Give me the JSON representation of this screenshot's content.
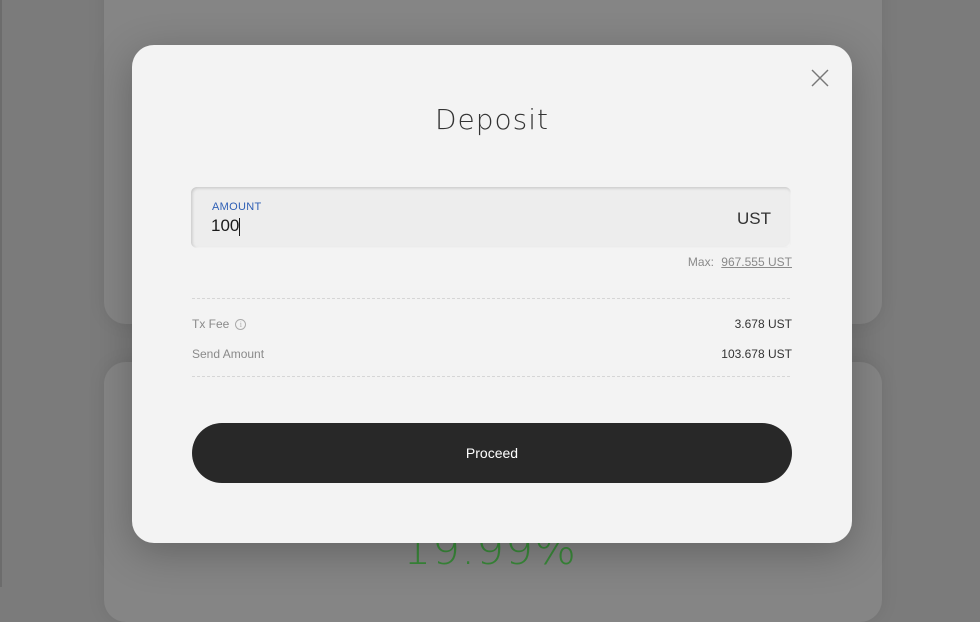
{
  "background": {
    "percent_text": "19.99%"
  },
  "modal": {
    "title": "Deposit",
    "close_icon": "close-icon",
    "amount": {
      "label": "AMOUNT",
      "value": "100",
      "unit": "UST"
    },
    "max": {
      "label": "Max:",
      "value": "967.555 UST"
    },
    "tx_fee": {
      "label": "Tx Fee",
      "value": "3.678 UST",
      "info_icon": "info-icon"
    },
    "send_amount": {
      "label": "Send Amount",
      "value": "103.678 UST"
    },
    "proceed_label": "Proceed"
  },
  "colors": {
    "overlay": "#7b7b7b",
    "modal_bg": "#f3f3f3",
    "label_accent": "#2e5fb5",
    "button_bg": "#282828",
    "percent_green": "#3a8a3a"
  }
}
